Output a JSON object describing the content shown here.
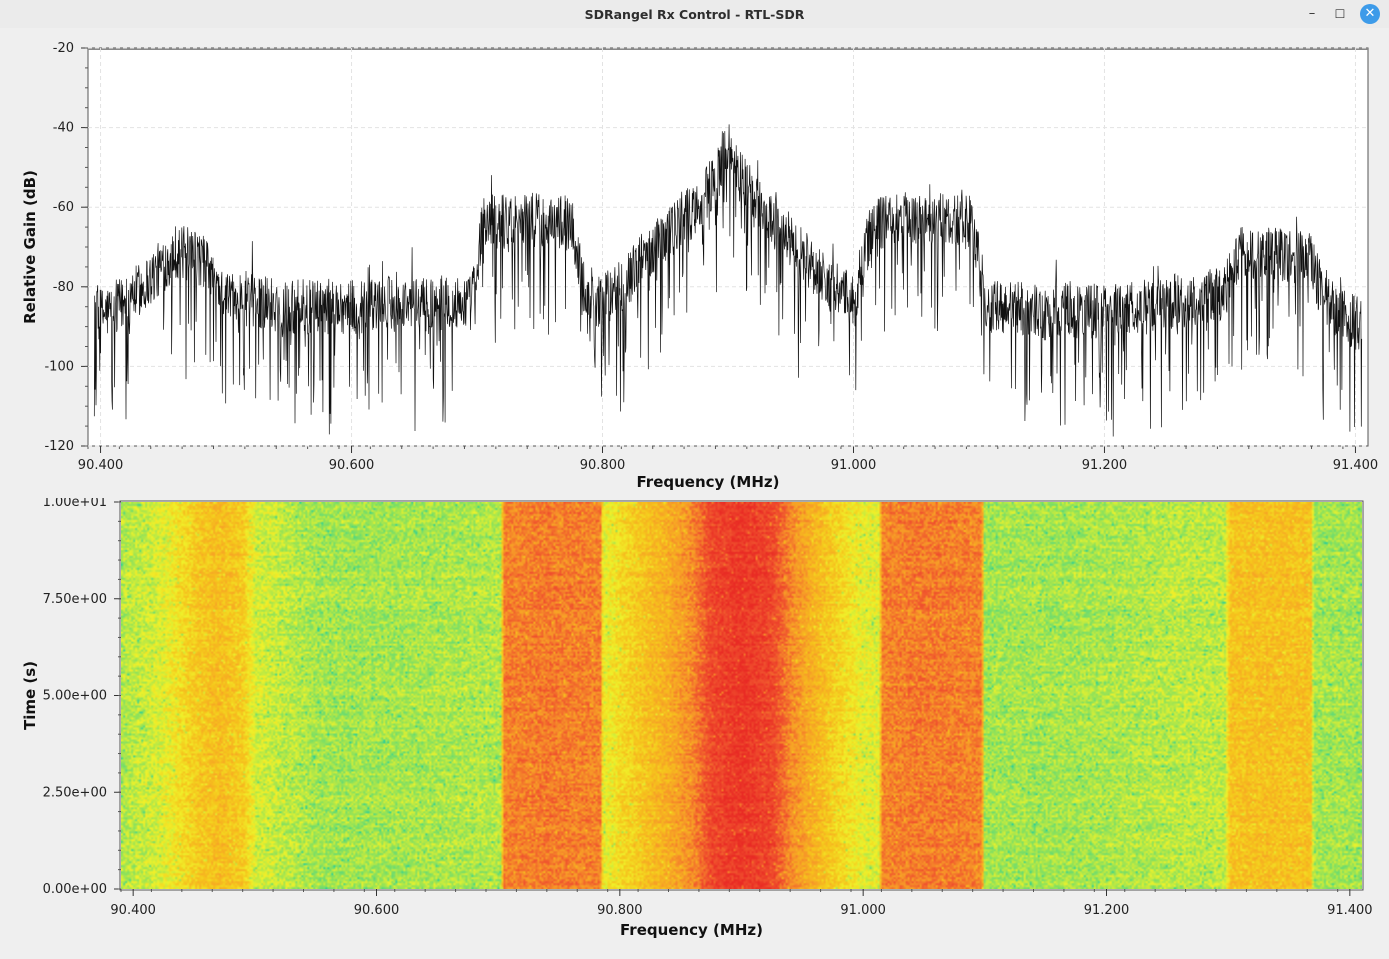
{
  "window": {
    "title": "SDRangel Rx Control - RTL-SDR",
    "minimize_glyph": "–",
    "maximize_glyph": "☐",
    "close_glyph": "✕"
  },
  "colors": {
    "trace": "#111111",
    "plot_background": "#ffffff",
    "window_background": "#efefef",
    "waterfall_palette": [
      "#15c4a4",
      "#2fd097",
      "#8fe25a",
      "#f0f22a",
      "#f6c41c",
      "#f79a28",
      "#f0522e",
      "#e92a24"
    ]
  },
  "chart_data": [
    {
      "type": "line",
      "title": "",
      "xlabel": "Frequency (MHz)",
      "ylabel": "Relative Gain (dB)",
      "xlim": [
        90.39,
        91.41
      ],
      "ylim": [
        -120,
        -20
      ],
      "x_ticks": [
        "90.400",
        "90.600",
        "90.800",
        "91.000",
        "91.200",
        "91.400"
      ],
      "x_tick_values": [
        90.4,
        90.6,
        90.8,
        91.0,
        91.2,
        91.4
      ],
      "y_ticks": [
        "-20",
        "-40",
        "-60",
        "-80",
        "-100",
        "-120"
      ],
      "y_tick_values": [
        -20,
        -40,
        -60,
        -80,
        -100,
        -120
      ],
      "grid": true,
      "series": [
        {
          "x": [
            90.395,
            90.42,
            90.44,
            90.46,
            90.48,
            90.5,
            90.55,
            90.6,
            90.65,
            90.695,
            90.705,
            90.74,
            90.775,
            90.785,
            90.8,
            90.82,
            90.84,
            90.86,
            90.88,
            90.895,
            90.9,
            90.905,
            90.92,
            90.94,
            90.96,
            90.98,
            91.0,
            91.015,
            91.05,
            91.095,
            91.105,
            91.15,
            91.2,
            91.25,
            91.295,
            91.305,
            91.33,
            91.365,
            91.375,
            91.39,
            91.405
          ],
          "y": [
            -88,
            -84,
            -78,
            -71,
            -73,
            -82,
            -85,
            -85,
            -84,
            -84,
            -64,
            -63,
            -64,
            -80,
            -84,
            -78,
            -70,
            -64,
            -58,
            -50,
            -44,
            -49,
            -58,
            -65,
            -72,
            -79,
            -84,
            -64,
            -63,
            -64,
            -85,
            -86,
            -86,
            -84,
            -82,
            -72,
            -71,
            -73,
            -84,
            -87,
            -90
          ]
        }
      ]
    },
    {
      "type": "heatmap",
      "title": "",
      "xlabel": "Frequency (MHz)",
      "ylabel": "Time (s)",
      "xlim": [
        90.39,
        91.41
      ],
      "ylim": [
        0,
        10
      ],
      "x_ticks": [
        "90.400",
        "90.600",
        "90.800",
        "91.000",
        "91.200",
        "91.400"
      ],
      "x_tick_values": [
        90.4,
        90.6,
        90.8,
        91.0,
        91.2,
        91.4
      ],
      "y_ticks": [
        "1.00e+01",
        "7.50e+00",
        "5.00e+00",
        "2.50e+00",
        "0.00e+00"
      ],
      "y_tick_values": [
        10,
        7.5,
        5,
        2.5,
        0
      ],
      "colormap": "jet",
      "levels": {
        "x": [
          90.39,
          90.42,
          90.45,
          90.47,
          90.49,
          90.5,
          90.55,
          90.6,
          90.65,
          90.702,
          90.704,
          90.74,
          90.784,
          90.786,
          90.8,
          90.82,
          90.84,
          90.86,
          90.875,
          90.9,
          90.925,
          90.94,
          90.96,
          90.98,
          91.0,
          91.013,
          91.016,
          91.05,
          91.098,
          91.1,
          91.15,
          91.2,
          91.25,
          91.298,
          91.302,
          91.33,
          91.369,
          91.371,
          91.41
        ],
        "value": [
          0.34,
          0.4,
          0.55,
          0.6,
          0.55,
          0.4,
          0.32,
          0.32,
          0.33,
          0.34,
          0.76,
          0.78,
          0.76,
          0.42,
          0.5,
          0.58,
          0.65,
          0.75,
          0.9,
          0.96,
          0.9,
          0.75,
          0.63,
          0.52,
          0.43,
          0.42,
          0.76,
          0.78,
          0.76,
          0.32,
          0.32,
          0.33,
          0.35,
          0.36,
          0.58,
          0.59,
          0.58,
          0.32,
          0.32
        ]
      }
    }
  ]
}
